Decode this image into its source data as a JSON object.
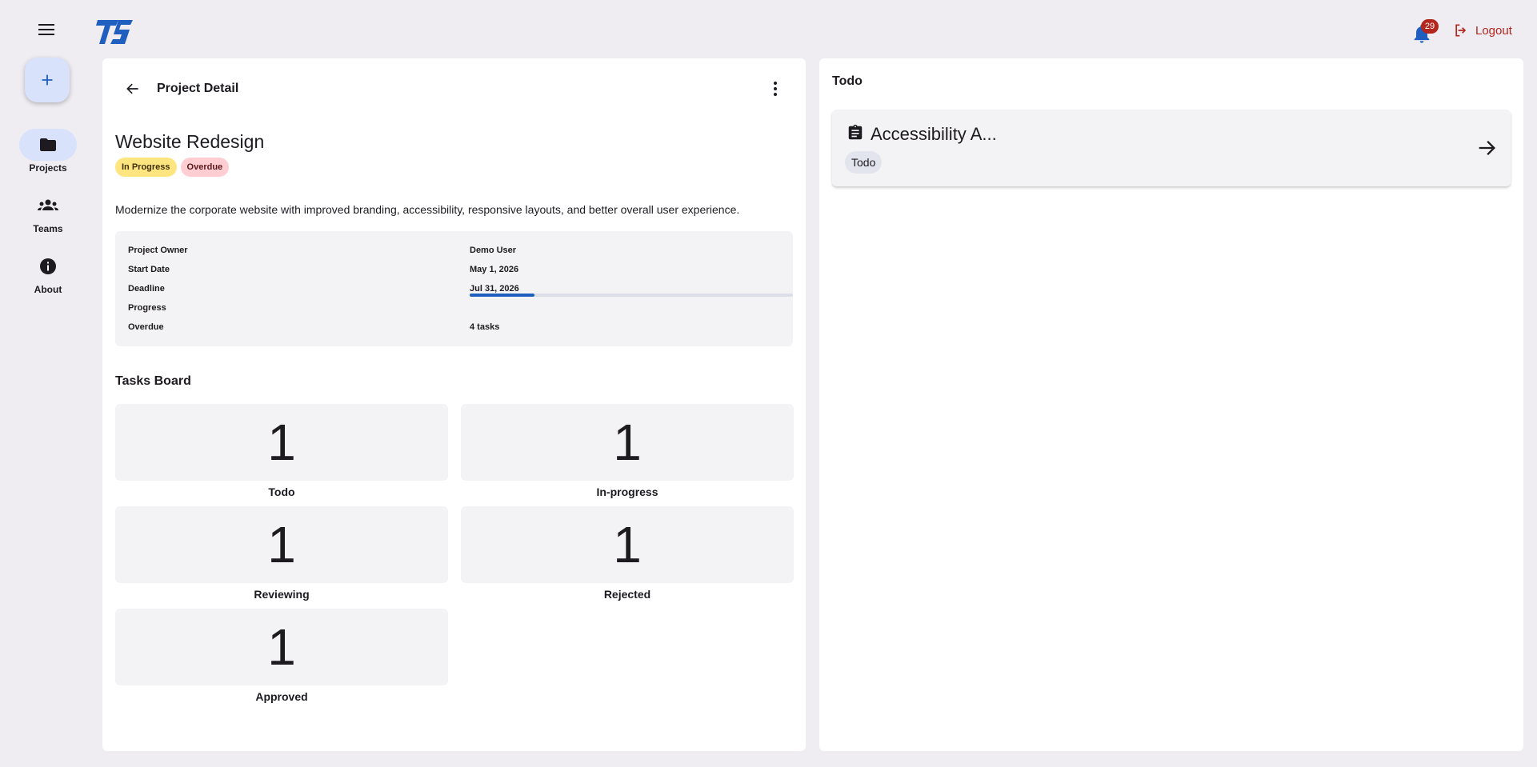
{
  "app": {
    "logo_text": "TG",
    "brand_color": "#1f5fbf"
  },
  "topbar": {
    "notifications_count": "29",
    "logout_label": "Logout"
  },
  "rail": {
    "add_icon": "plus-icon",
    "items": [
      {
        "label": "Projects",
        "icon": "folder-icon",
        "active": true
      },
      {
        "label": "Teams",
        "icon": "groups-icon",
        "active": false
      },
      {
        "label": "About",
        "icon": "info-icon",
        "active": false
      }
    ]
  },
  "project": {
    "header_title": "Project Detail",
    "name": "Website Redesign",
    "status_chip": "In Progress",
    "overdue_chip": "Overdue",
    "description": "Modernize the corporate website with improved branding, accessibility, responsive layouts, and better overall user experience.",
    "info": {
      "owner_label": "Project Owner",
      "owner_value": "Demo User",
      "start_label": "Start Date",
      "start_value": "May 1, 2026",
      "deadline_label": "Deadline",
      "deadline_value": "Jul 31, 2026",
      "progress_label": "Progress",
      "progress_fraction": 0.2,
      "overdue_label": "Overdue",
      "overdue_value": "4 tasks"
    }
  },
  "tasks_board": {
    "title": "Tasks Board",
    "items": [
      {
        "count": "1",
        "label": "Todo"
      },
      {
        "count": "1",
        "label": "In-progress"
      },
      {
        "count": "1",
        "label": "Reviewing"
      },
      {
        "count": "1",
        "label": "Rejected"
      },
      {
        "count": "1",
        "label": "Approved"
      }
    ]
  },
  "todo_panel": {
    "title": "Todo",
    "tasks": [
      {
        "name": "Accessibility A...",
        "status": "Todo",
        "icon": "clipboard-icon"
      }
    ]
  }
}
